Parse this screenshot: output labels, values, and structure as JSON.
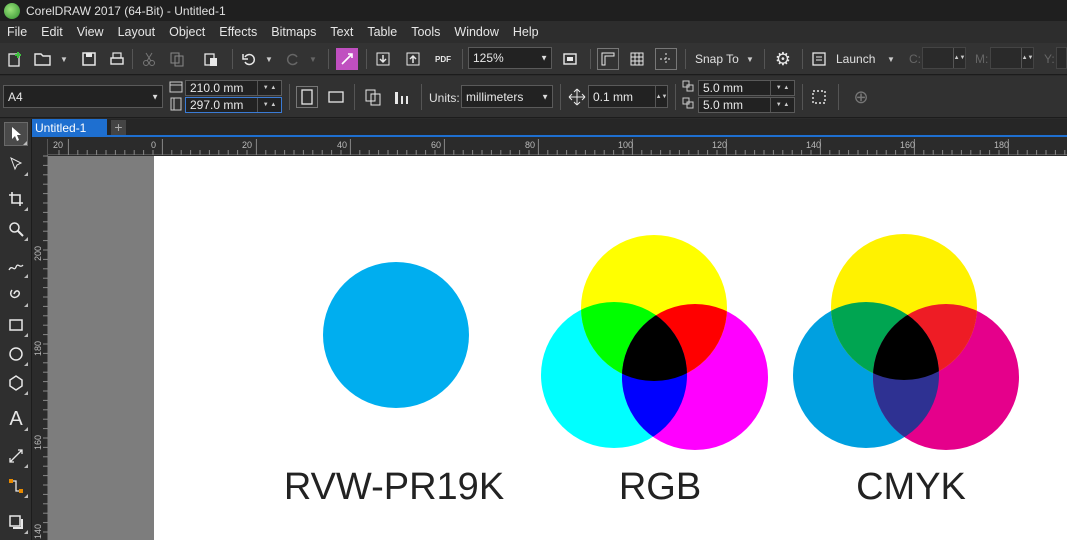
{
  "window": {
    "title": "CorelDRAW 2017 (64-Bit) - Untitled-1"
  },
  "menu": [
    "File",
    "Edit",
    "View",
    "Layout",
    "Object",
    "Effects",
    "Bitmaps",
    "Text",
    "Table",
    "Tools",
    "Window",
    "Help"
  ],
  "toolbar1": {
    "zoom": "125%",
    "snap_label": "Snap To",
    "launch_label": "Launch",
    "pdf_label": "PDF",
    "coord_labels": {
      "c": "C:",
      "m": "M:",
      "y": "Y:"
    },
    "icons": [
      "new-document-icon",
      "open-icon",
      "save-icon",
      "print-icon",
      "cut-icon",
      "copy-icon",
      "paste-icon",
      "undo-icon",
      "redo-icon",
      "corel-connect-icon",
      "import-icon",
      "export-icon",
      "publish-pdf-icon",
      "full-screen-icon",
      "show-rulers-icon",
      "show-grid-icon",
      "show-guidelines-icon",
      "options-gear-icon",
      "launch-icon"
    ]
  },
  "toolbar2": {
    "page_size": "A4",
    "width": "210.0 mm",
    "height": "297.0 mm",
    "units_label": "Units:",
    "units_value": "millimeters",
    "nudge": "0.1 mm",
    "dup_x": "5.0 mm",
    "dup_y": "5.0 mm",
    "icons": [
      "portrait-icon",
      "landscape-icon",
      "all-pages-icon",
      "current-page-icon",
      "nudge-icon",
      "duplicate-distance-icon",
      "treat-as-filled-icon",
      "add-icon"
    ]
  },
  "toolbox": [
    "pick-tool-icon",
    "shape-tool-icon",
    "crop-tool-icon",
    "zoom-tool-icon",
    "freehand-tool-icon",
    "artistic-media-icon",
    "rectangle-tool-icon",
    "ellipse-tool-icon",
    "polygon-tool-icon",
    "text-tool-icon",
    "dimension-tool-icon",
    "connector-tool-icon",
    "drop-shadow-tool-icon"
  ],
  "tabs": {
    "document": "Untitled-1",
    "add": "+"
  },
  "ruler": {
    "h_labels": [
      "20",
      "0",
      "20",
      "40",
      "60",
      "80",
      "100",
      "120",
      "140",
      "160",
      "180"
    ],
    "v_labels": [
      "200",
      "180",
      "160",
      "140"
    ]
  },
  "canvas": {
    "single_circle_color": "#00aeef",
    "rgb": {
      "red": "#ff0000",
      "green": "#00ff00",
      "blue": "#0000ff",
      "yellow": "#ffff00",
      "cyan": "#00ffff",
      "magenta": "#ff00ff",
      "black": "#000000"
    },
    "cmyk": {
      "cyan": "#00a0e0",
      "magenta": "#e5008b",
      "yellow": "#fff200",
      "green": "#00a551",
      "red": "#ee1c25",
      "blue": "#2e3192",
      "black": "#000000"
    },
    "captions": {
      "single": "RVW-PR19K",
      "rgb": "RGB",
      "cmyk": "CMYK"
    }
  }
}
